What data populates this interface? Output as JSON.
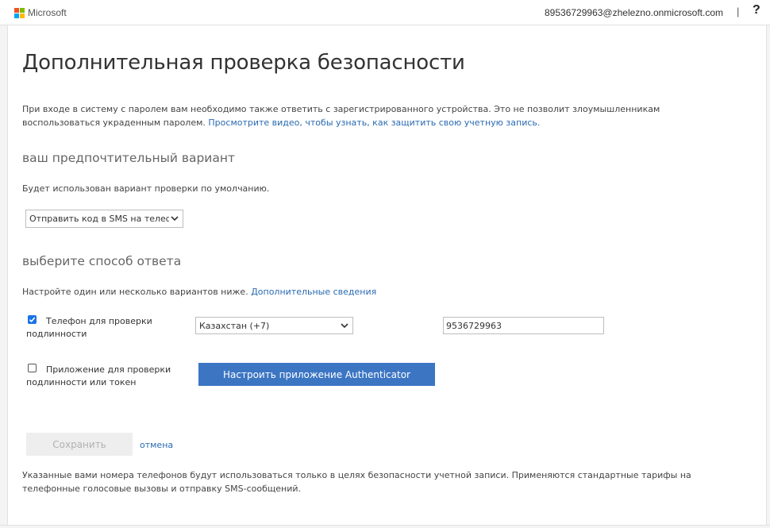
{
  "header": {
    "logo_text": "Microsoft",
    "logo_colors": [
      "#f25022",
      "#7fba00",
      "#00a4ef",
      "#ffb900"
    ],
    "user_email": "89536729963@zhelezno.onmicrosoft.com",
    "separator": "|",
    "help_label": "?"
  },
  "page": {
    "title": "Дополнительная проверка безопасности",
    "intro_text": "При входе в систему с паролем вам необходимо также ответить с зарегистрированного устройства. Это не позволит злоумышленникам воспользоваться украденным паролем. ",
    "intro_link": "Просмотрите видео, чтобы узнать, как защитить свою учетную запись."
  },
  "preferred": {
    "title": "ваш предпочтительный вариант",
    "description": "Будет использован вариант проверки по умолчанию.",
    "selected": "Отправить код в SMS на телефон проверки подлинности"
  },
  "response": {
    "title": "выберите способ ответа",
    "description": "Настройте один или несколько вариантов ниже. ",
    "more_link": "Дополнительные сведения",
    "phone_option": {
      "checked": true,
      "label": "Телефон для проверки подлинности",
      "country": "Казахстан (+7)",
      "phone_value": "9536729963"
    },
    "app_option": {
      "checked": false,
      "label": "Приложение для проверки подлинности или токен",
      "button_label": "Настроить приложение Authenticator"
    }
  },
  "actions": {
    "save_label": "Сохранить",
    "cancel_label": "отмена"
  },
  "footer": {
    "note": "Указанные вами номера телефонов будут использоваться только в целях безопасности учетной записи. Применяются стандартные тарифы на телефонные голосовые вызовы и отправку SMS-сообщений."
  },
  "colors": {
    "accent": "#3c76c3",
    "link": "#2a6ab0",
    "checkbox": "#1a73e8"
  }
}
